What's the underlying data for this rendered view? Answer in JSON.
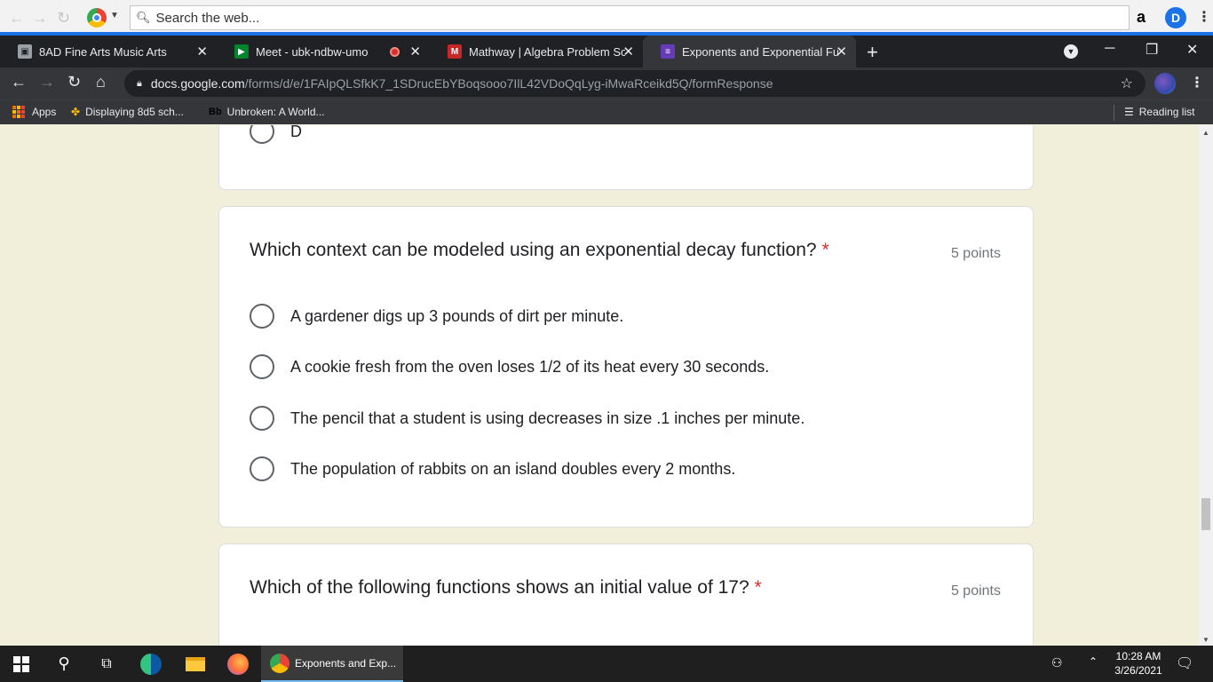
{
  "search_toolbar": {
    "placeholder": "Search the web...",
    "amazon_label": "a",
    "profile_letter": "D"
  },
  "tabs": [
    {
      "title": "8AD Fine Arts Music Arts",
      "favicon": "classroom-icon",
      "active": false,
      "recording": false
    },
    {
      "title": "Meet - ubk-ndbw-umo",
      "favicon": "meet-icon",
      "active": false,
      "recording": true
    },
    {
      "title": "Mathway | Algebra Problem Solver",
      "favicon": "mathway-icon",
      "active": false,
      "recording": false
    },
    {
      "title": "Exponents and Exponential Functions",
      "favicon": "forms-icon",
      "active": true,
      "recording": false
    }
  ],
  "address": {
    "host": "docs.google.com",
    "path": "/forms/d/e/1FAIpQLSfkK7_1SDrucEbYBoqsooo7IlL42VDoQqLyg-iMwaRceikd5Q/formResponse"
  },
  "bookmarks": {
    "apps": "Apps",
    "items": [
      "Displaying 8d5 sch...",
      "Unbroken: A World..."
    ],
    "reading_list": "Reading list"
  },
  "form": {
    "prev_question_last_option": "D",
    "questions": [
      {
        "title": "Which context can be modeled using an exponential decay function?",
        "required_mark": "*",
        "points": "5 points",
        "options": [
          "A gardener digs up 3 pounds of dirt per minute.",
          "A cookie fresh from the oven loses 1/2 of its heat every 30 seconds.",
          "The pencil that a student is using decreases in size .1 inches per minute.",
          "The population of rabbits on an island doubles every 2 months."
        ]
      },
      {
        "title": "Which of the following functions shows an initial value of 17?",
        "required_mark": "*",
        "points": "5 points"
      }
    ]
  },
  "taskbar": {
    "active_app": "Exponents and Exp...",
    "time": "10:28 AM",
    "date": "3/26/2021"
  },
  "colors": {
    "page_background": "#f1efd9",
    "required_red": "#d93025",
    "chrome_dark": "#35363a",
    "accent_blue": "#1a73e8"
  }
}
